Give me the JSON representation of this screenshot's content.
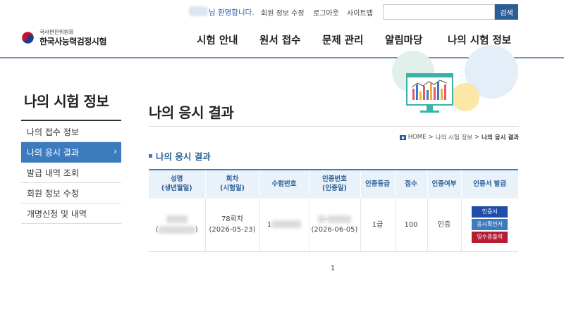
{
  "header": {
    "welcome": "님 환영합니다.",
    "links": [
      "회원 정보 수정",
      "로그아웃",
      "사이트맵"
    ],
    "search_placeholder": "",
    "search_button": "검색",
    "logo_sub": "국사편찬위원회",
    "logo_main": "한국사능력검정시험",
    "nav": [
      "시험 안내",
      "원서 접수",
      "문제 관리",
      "알림마당",
      "나의 시험 정보"
    ]
  },
  "sidebar": {
    "title": "나의 시험 정보",
    "items": [
      {
        "label": "나의 접수 정보",
        "active": false
      },
      {
        "label": "나의 응시 결과",
        "active": true
      },
      {
        "label": "발급 내역 조회",
        "active": false
      },
      {
        "label": "회원 정보 수정",
        "active": false
      },
      {
        "label": "개명신청 및 내역",
        "active": false
      }
    ],
    "active_chevron": "›"
  },
  "main": {
    "title": "나의 응시 결과",
    "breadcrumb": [
      "HOME",
      "나의 시험 정보",
      "나의 응시 결과"
    ],
    "breadcrumb_sep": ">",
    "section_title": "나의 응시 결과",
    "table": {
      "headers": [
        [
          "성명",
          "(생년월일)"
        ],
        [
          "회차",
          "(시험일)"
        ],
        [
          "수험번호"
        ],
        [
          "인증번호",
          "(인증일)"
        ],
        [
          "인증등급"
        ],
        [
          "점수"
        ],
        [
          "인증여부"
        ],
        [
          "인증서 발급"
        ]
      ],
      "row": {
        "name_paren_open": "(",
        "name_paren_close": ")",
        "round": "78회차",
        "exam_date": "(2026-05-23)",
        "exam_no_prefix": "1",
        "cert_no_sep": "-",
        "cert_date": "(2026-06-05)",
        "grade": "1급",
        "score": "100",
        "status": "인증",
        "buttons": [
          "인증서",
          "응시확인서",
          "영수증출력"
        ]
      }
    },
    "page": "1"
  },
  "colors": {
    "primary": "#2c5d96",
    "accent": "#3d7bbf",
    "receipt": "#b51d34",
    "cert": "#1f4ea8"
  }
}
